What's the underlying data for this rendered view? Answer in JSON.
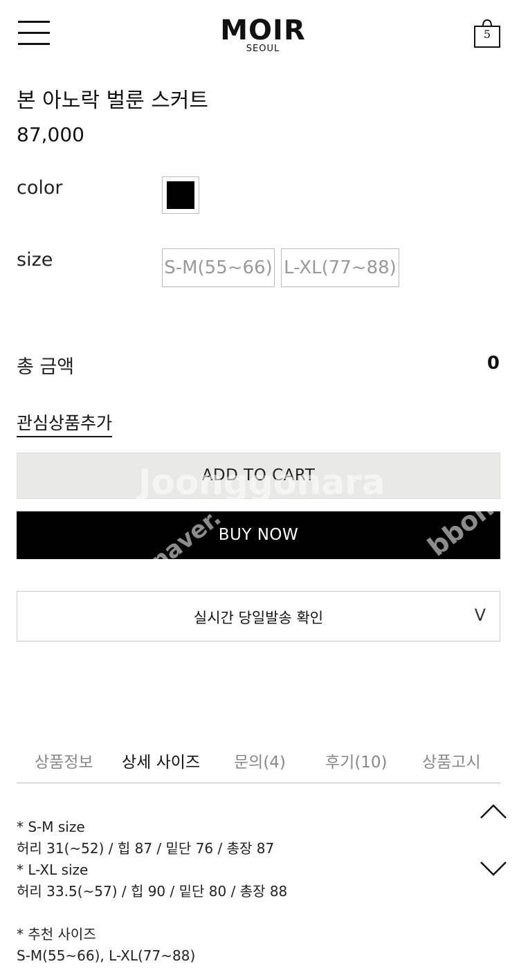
{
  "header": {
    "logo_main": "MOIR",
    "logo_sub": "SEOUL",
    "cart_count": "5"
  },
  "product": {
    "name": "본 아노락 벌룬 스커트",
    "price": "87,000",
    "color_label": "color",
    "color_swatch": "#000000",
    "size_label": "size",
    "sizes": [
      "S-M(55~66)",
      "L-XL(77~88)"
    ]
  },
  "total": {
    "label": "총 금액",
    "value": "0"
  },
  "actions": {
    "wishlist": "관심상품추가",
    "add_to_cart": "ADD TO CART",
    "buy_now": "BUY NOW"
  },
  "shipping": {
    "label": "실시간 당일발송 확인",
    "chevron": "V"
  },
  "tabs": [
    "상품정보",
    "상세 사이즈",
    "문의(4)",
    "후기(10)",
    "상품고시"
  ],
  "details": {
    "lines": [
      "* S-M size",
      "허리 31(~52) / 힙 87 / 밑단 76 / 총장 87",
      "* L-XL size",
      "허리 33.5(~57) / 힙 90 / 밑단 80 / 총장 88",
      "",
      "* 추천 사이즈",
      "S-M(55~66), L-XL(77~88)"
    ]
  },
  "watermarks": [
    "Joonggonara",
    "naver.",
    "bbon"
  ]
}
